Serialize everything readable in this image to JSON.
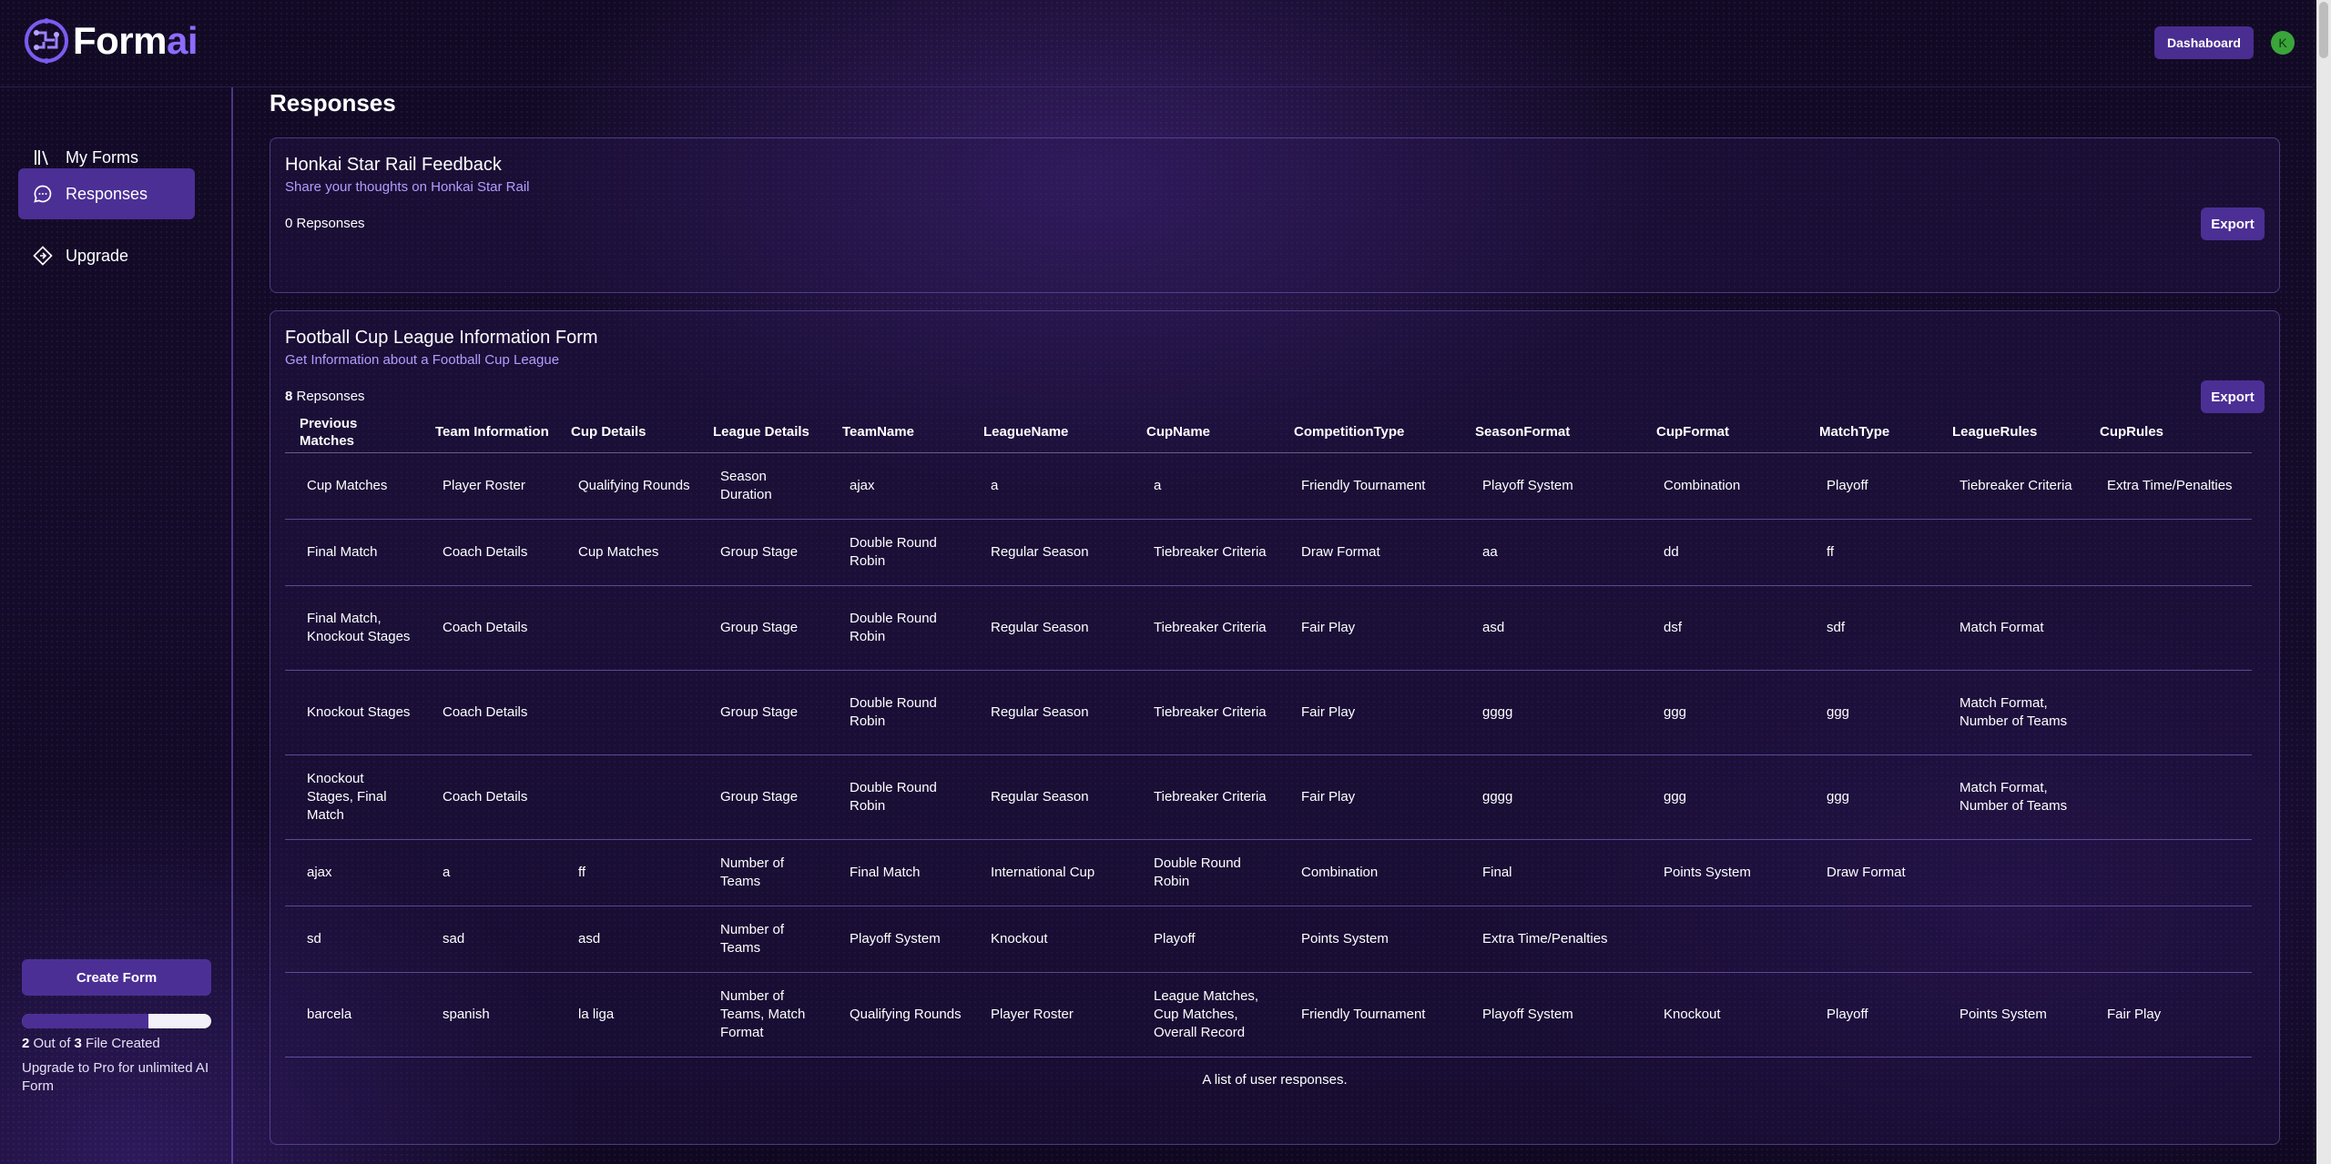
{
  "header": {
    "logo_text": "Form",
    "logo_accent": "ai",
    "dashboard_label": "Dashaboard",
    "avatar_initial": "K"
  },
  "sidebar": {
    "items": [
      {
        "label": "My Forms",
        "icon": "library-icon"
      },
      {
        "label": "Responses",
        "icon": "chat-bubble-icon"
      },
      {
        "label": "Upgrade",
        "icon": "diamond-icon"
      }
    ],
    "create_label": "Create Form",
    "usage": {
      "used": "2",
      "out_of": " Out of ",
      "total": "3",
      "suffix": " File Created",
      "fraction": 0.667
    },
    "upgrade_note": "Upgrade to Pro for unlimited AI Form"
  },
  "main": {
    "title": "Responses",
    "forms": [
      {
        "title": "Honkai Star Rail Feedback",
        "subtitle": "Share your thoughts on Honkai Star Rail",
        "count": "0",
        "count_label": " Repsonses",
        "export_label": "Export"
      },
      {
        "title": "Football Cup League Information Form",
        "subtitle": "Get Information about a Football Cup League",
        "count": "8",
        "count_label": " Repsonses",
        "export_label": "Export",
        "caption": "A list of user responses.",
        "columns": [
          "Previous Matches",
          "Team Information",
          "Cup Details",
          "League Details",
          "TeamName",
          "LeagueName",
          "CupName",
          "CompetitionType",
          "SeasonFormat",
          "CupFormat",
          "MatchType",
          "LeagueRules",
          "CupRules"
        ],
        "rows": [
          [
            "Cup Matches",
            "Player Roster",
            "Qualifying Rounds",
            "Season Duration",
            "ajax",
            "a",
            "a",
            "Friendly Tournament",
            "Playoff System",
            "Combination",
            "Playoff",
            "Tiebreaker Criteria",
            "Extra Time/Penalties"
          ],
          [
            "Final Match",
            "Coach Details",
            "Cup Matches",
            "Group Stage",
            "Double Round Robin",
            "Regular Season",
            "Tiebreaker Criteria",
            "Draw Format",
            "aa",
            "dd",
            "ff",
            "",
            ""
          ],
          [
            "Final Match, Knockout Stages",
            "Coach Details",
            "",
            "Group Stage",
            "Double Round Robin",
            "Regular Season",
            "Tiebreaker Criteria",
            "Fair Play",
            "asd",
            "dsf",
            "sdf",
            "Match Format",
            ""
          ],
          [
            "Knockout Stages",
            "Coach Details",
            "",
            "Group Stage",
            "Double Round Robin",
            "Regular Season",
            "Tiebreaker Criteria",
            "Fair Play",
            "gggg",
            "ggg",
            "ggg",
            "Match Format, Number of Teams",
            ""
          ],
          [
            "Knockout Stages, Final Match",
            "Coach Details",
            "",
            "Group Stage",
            "Double Round Robin",
            "Regular Season",
            "Tiebreaker Criteria",
            "Fair Play",
            "gggg",
            "ggg",
            "ggg",
            "Match Format, Number of Teams",
            ""
          ],
          [
            "ajax",
            "a",
            "ff",
            "Number of Teams",
            "Final Match",
            "International Cup",
            "Double Round Robin",
            "Combination",
            "Final",
            "Points System",
            "Draw Format",
            "",
            ""
          ],
          [
            "sd",
            "sad",
            "asd",
            "Number of Teams",
            "Playoff System",
            "Knockout",
            "Playoff",
            "Points System",
            "Extra Time/Penalties",
            "",
            "",
            "",
            ""
          ],
          [
            "barcela",
            "spanish",
            "la liga",
            "Number of Teams, Match Format",
            "Qualifying Rounds",
            "Player Roster",
            "League Matches, Cup Matches, Overall Record",
            "Friendly Tournament",
            "Playoff System",
            "Knockout",
            "Playoff",
            "Points System",
            "Fair Play"
          ]
        ]
      }
    ]
  }
}
